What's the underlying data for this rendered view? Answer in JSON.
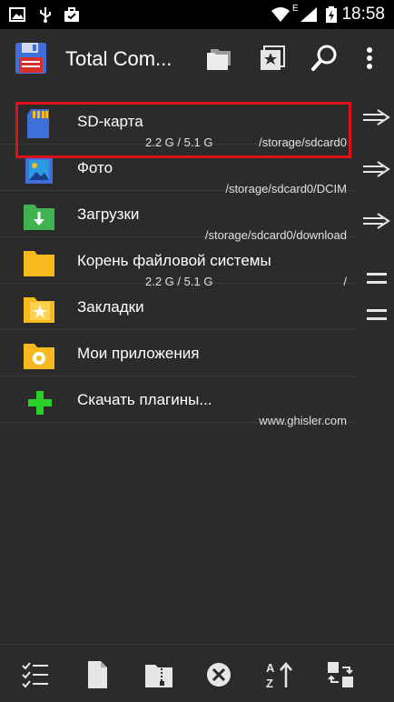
{
  "status_bar": {
    "time": "18:58",
    "network_label": "E",
    "left_icons": [
      "image-icon",
      "usb-icon",
      "briefcase-icon"
    ],
    "right_icons": [
      "wifi-icon",
      "signal-icon",
      "battery-icon"
    ]
  },
  "app_bar": {
    "title": "Total Com...",
    "app_icon": "floppy-disk-icon",
    "actions": [
      "folders-icon",
      "bookmark-star-icon",
      "search-icon",
      "more-vertical-icon"
    ]
  },
  "locations": [
    {
      "name": "SD-карта",
      "size": "2.2 G / 5.1 G",
      "path": "/storage/sdcard0",
      "icon": "sd-card-icon",
      "selected": true,
      "side_action": "arrow-right-icon"
    },
    {
      "name": "Фото",
      "size": "",
      "path": "/storage/sdcard0/DCIM",
      "icon": "photo-icon",
      "selected": false,
      "side_action": "arrow-right-icon"
    },
    {
      "name": "Загрузки",
      "size": "",
      "path": "/storage/sdcard0/download",
      "icon": "download-folder-icon",
      "selected": false,
      "side_action": "arrow-right-icon"
    },
    {
      "name": "Корень файловой системы",
      "size": "2.2 G / 5.1 G",
      "path": "/",
      "icon": "folder-icon",
      "selected": false,
      "side_action": "menu-icon"
    },
    {
      "name": "Закладки",
      "size": "",
      "path": "",
      "icon": "bookmarks-folder-icon",
      "selected": false,
      "side_action": "menu-icon"
    },
    {
      "name": "Мои приложения",
      "size": "",
      "path": "",
      "icon": "apps-folder-icon",
      "selected": false,
      "side_action": ""
    },
    {
      "name": "Скачать плагины...",
      "size": "",
      "path": "www.ghisler.com",
      "icon": "plus-icon",
      "selected": false,
      "side_action": ""
    }
  ],
  "toolbar": {
    "buttons": [
      "select-list-icon",
      "new-file-icon",
      "zip-file-icon",
      "close-circle-icon",
      "sort-az-icon",
      "swap-panels-icon"
    ]
  },
  "colors": {
    "background": "#2b2b2b",
    "status_bar": "#000000",
    "highlight_border": "#e0101a",
    "folder": "#f6b91f",
    "sd_card": "#3f6fd8",
    "plus": "#2bd12b"
  }
}
